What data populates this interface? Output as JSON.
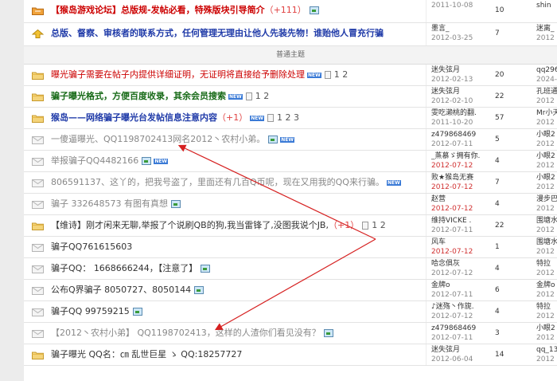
{
  "divider_label": "普通主题",
  "rows": [
    {
      "icon": "announcement-icon",
      "title": "【猴岛游戏论坛】总版规-发帖必看，特殊版块引导简介",
      "title_class": "red bold",
      "plus": "（+111）",
      "extras": [
        "img"
      ],
      "author": "",
      "date": "2011-10-08",
      "date_red": false,
      "replies": "10",
      "last_user": "shin",
      "last_date": ""
    },
    {
      "icon": "upvote-icon",
      "title": "总版、督察、审核者的联系方式，任何管理无理由让他人先装先物！谁贻他人冒充行骗",
      "title_class": "blue bold",
      "plus": "",
      "extras": [],
      "author": "墨言_",
      "date": "2012-03-25",
      "date_red": false,
      "replies": "7",
      "last_user": "迷离_",
      "last_date": "2012"
    },
    {
      "divider": true
    },
    {
      "icon": "folder-icon",
      "title": "曝光骗子需要在帖子内提供详细证明，无证明将直接给予删除处理",
      "title_class": "red",
      "plus": "",
      "extras": [
        "new",
        "page"
      ],
      "pages": "1 2",
      "author": "迷失弦月",
      "date": "2012-02-13",
      "date_red": false,
      "replies": "20",
      "last_user": "qq296",
      "last_date": "2024-1"
    },
    {
      "icon": "folder-icon",
      "title": "骗子曝光格式，方便百度收录，其余会员搜索",
      "title_class": "green bold",
      "plus": "",
      "extras": [
        "new",
        "page"
      ],
      "pages": "1 2",
      "author": "迷失弦月",
      "date": "2012-02-10",
      "date_red": false,
      "replies": "22",
      "last_user": "孔班通",
      "last_date": "2012"
    },
    {
      "icon": "folder-icon",
      "title": "猴岛——网络骗子曝光台发帖信息注意内容",
      "title_class": "blue bold",
      "plus": "（+1）",
      "extras": [
        "new",
        "page"
      ],
      "pages": "1 2 3",
      "author": "雯吃濑桃的翻.",
      "date": "2011-10-20",
      "date_red": false,
      "replies": "57",
      "last_user": "Mr小天",
      "last_date": "2012"
    },
    {
      "icon": "envelope-icon",
      "title": "一傻逼曝光、QQ1198702413网名2012丶农村小弟。",
      "title_class": "gray",
      "plus": "",
      "extras": [
        "img",
        "new"
      ],
      "author": "z479868469",
      "date": "2012-07-11",
      "date_red": false,
      "replies": "5",
      "last_user": "小眼2",
      "last_date": "2012"
    },
    {
      "icon": "envelope-icon",
      "title": "举报骗子QQ4482166",
      "title_class": "gray",
      "plus": "",
      "extras": [
        "img",
        "new"
      ],
      "author": "_蒸慕ゞ拥有你.",
      "date": "2012-07-12",
      "date_red": true,
      "replies": "4",
      "last_user": "小眼2",
      "last_date": "2012"
    },
    {
      "icon": "envelope-icon",
      "title": "806591137、这丫的，把我号盗了，里面还有几百Q币呢，现在又用我的QQ来行骗。",
      "title_class": "gray",
      "plus": "",
      "extras": [
        "new"
      ],
      "author": "败★猴岛无赛",
      "date": "2012-07-12",
      "date_red": true,
      "replies": "7",
      "last_user": "小眼2",
      "last_date": "2012"
    },
    {
      "icon": "envelope-icon",
      "title": "骗子 332648573 有图有真想",
      "title_class": "gray",
      "plus": "",
      "extras": [
        "img"
      ],
      "author": "赵营",
      "date": "2012-07-12",
      "date_red": true,
      "replies": "4",
      "last_user": "漫步巴",
      "last_date": "2012"
    },
    {
      "icon": "folder-icon",
      "title": "【维诗】刚才闲来无聊,举报了个说刷QB的狗,我当雷锋了,没图我说个JB,",
      "title_class": "",
      "plus": "（+1）",
      "extras": [
        "page"
      ],
      "pages": "1 2",
      "author": "维持VICKE .",
      "date": "2012-07-11",
      "date_red": false,
      "replies": "22",
      "last_user": "围塘水",
      "last_date": "2012"
    },
    {
      "icon": "envelope-icon",
      "title": "骗子QQ761615603",
      "title_class": "",
      "plus": "",
      "extras": [],
      "author": "风车",
      "date": "2012-07-12",
      "date_red": true,
      "replies": "1",
      "last_user": "围塘水",
      "last_date": "2012"
    },
    {
      "icon": "envelope-icon",
      "title": "骗子QQ： 1668666244，【注意了】",
      "title_class": "",
      "plus": "",
      "extras": [
        "img"
      ],
      "author": "哈念俱灰",
      "date": "2012-07-12",
      "date_red": false,
      "replies": "4",
      "last_user": "特拉",
      "last_date": "2012"
    },
    {
      "icon": "envelope-icon",
      "title": "公布Q界骗子 8050727、8050144",
      "title_class": "",
      "plus": "",
      "extras": [
        "img"
      ],
      "author": "金牌o",
      "date": "2012-07-11",
      "date_red": false,
      "replies": "6",
      "last_user": "金牌o",
      "last_date": "2012"
    },
    {
      "icon": "envelope-icon",
      "title": "骗子QQ 99759215",
      "title_class": "",
      "plus": "",
      "extras": [
        "img"
      ],
      "author": "♪迷殇丶作旎.",
      "date": "2012-07-12",
      "date_red": false,
      "replies": "4",
      "last_user": "特拉",
      "last_date": "2012"
    },
    {
      "icon": "envelope-icon",
      "title": "【2012丶农村小弟】 QQ1198702413，这样的人渣你们看见没有？",
      "title_class": "gray",
      "plus": "",
      "extras": [
        "img"
      ],
      "author": "z479868469",
      "date": "2012-07-11",
      "date_red": false,
      "replies": "3",
      "last_user": "小眼2",
      "last_date": "2012"
    },
    {
      "icon": "folder-icon",
      "title": "骗子曝光 QQ名：㎝ 乱世巨星 ゝ QQ:18257727",
      "title_class": "",
      "plus": "",
      "extras": [],
      "author": "迷失弦月",
      "date": "2012-06-04",
      "date_red": false,
      "replies": "14",
      "last_user": "qq_13",
      "last_date": "2012"
    }
  ]
}
